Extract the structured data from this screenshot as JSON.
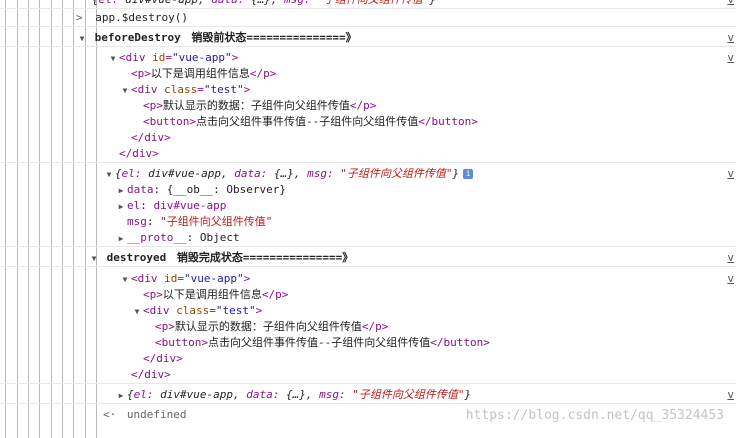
{
  "console": {
    "top_cut_line": "{el: div#vue-app, data: {…}, msg: \"子组件向父组件传值\"}",
    "command": "app.$destroy()",
    "source_link": "v",
    "before_label": "beforeDestroy",
    "before_state": "销毁前状态===============》",
    "destroyed_label": "destroyed",
    "destroyed_state": "销毁完成状态===============》",
    "dom": {
      "div_tag": "div",
      "id_attr": "id",
      "id_val": "\"vue-app\"",
      "class_attr": "class",
      "class_val": "\"test\"",
      "p1_text": "以下是调用组件信息",
      "p2_text": "默认显示的数据：子组件向父组件传值",
      "button_text": "点击向父组件事件传值--子组件向父组件传值"
    },
    "vm": {
      "el": "div#vue-app",
      "data": "{…}",
      "msg": "\"子组件向父组件传值\"",
      "data_prop": "data",
      "data_value": "{__ob__: Observer}",
      "el_prop": "el",
      "el_value": "div#vue-app",
      "msg_prop": "msg",
      "msg_value": "\"子组件向父组件传值\"",
      "proto_prop": "__proto__",
      "proto_value": "Object"
    },
    "result": "undefined",
    "watermark": "https://blog.csdn.net/qq_35324453"
  }
}
